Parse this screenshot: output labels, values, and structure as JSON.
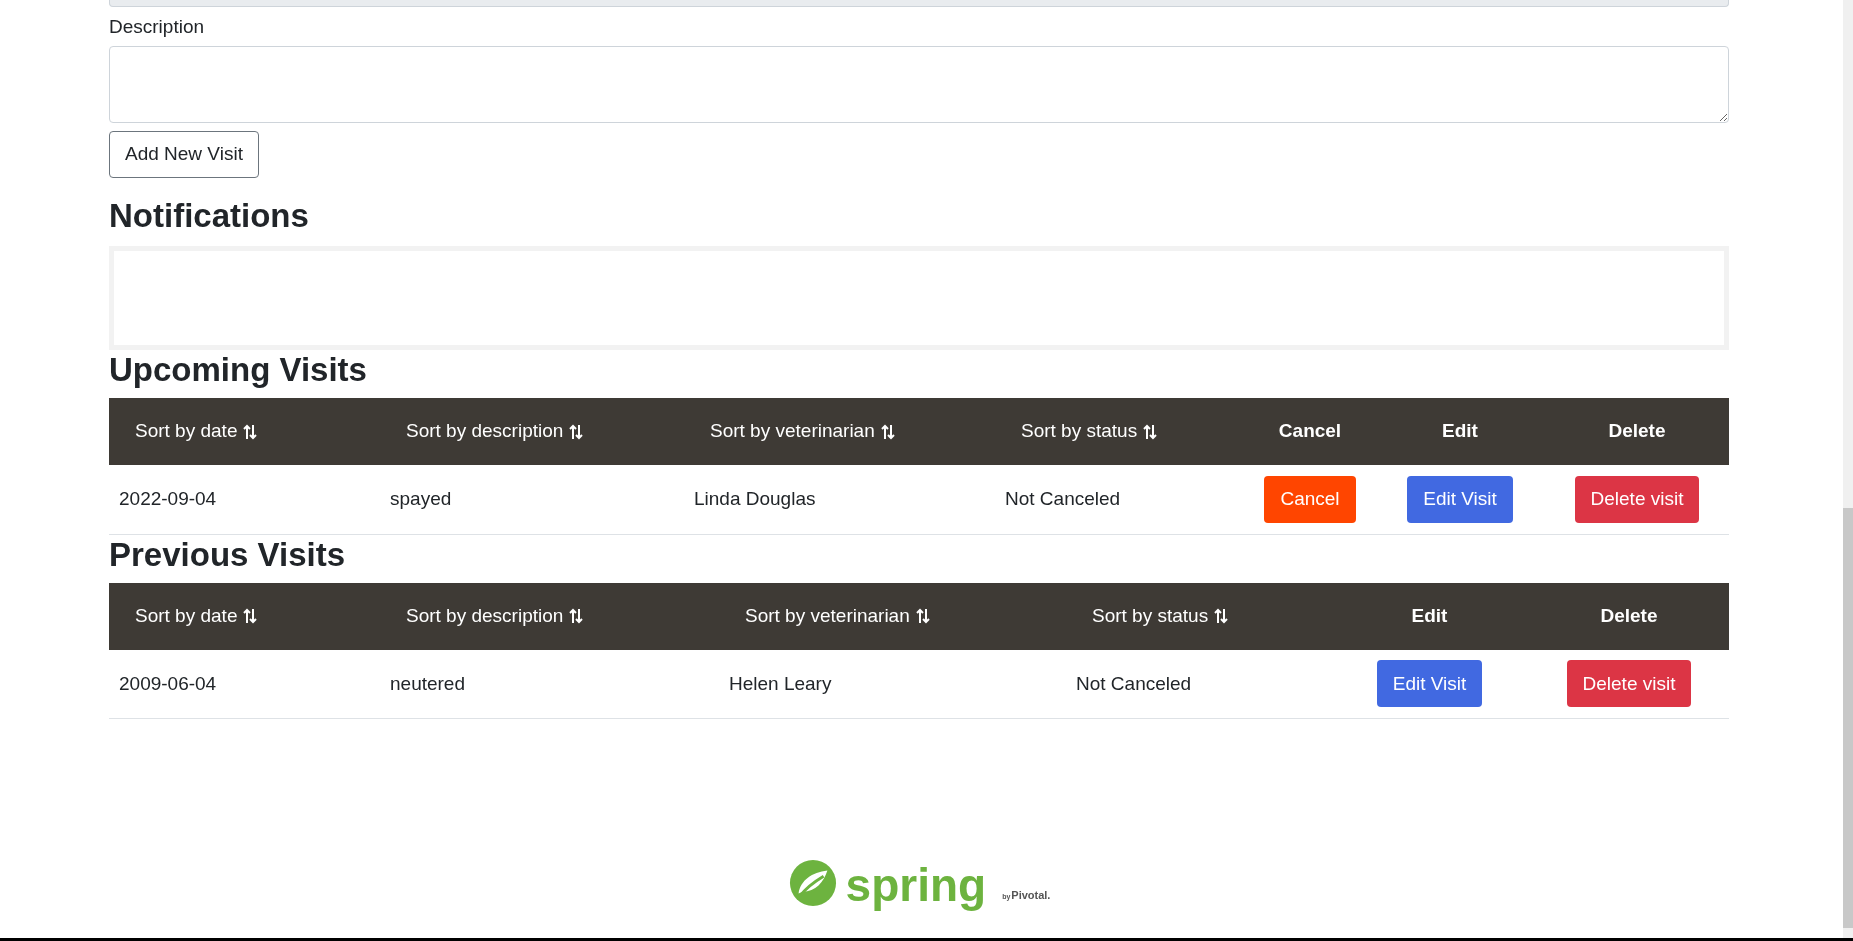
{
  "form": {
    "description_label": "Description",
    "add_button": "Add New Visit"
  },
  "notifications": {
    "title": "Notifications"
  },
  "upcoming": {
    "title": "Upcoming Visits",
    "columns": [
      {
        "label": "Sort by date",
        "kind": "sort"
      },
      {
        "label": "Sort by description",
        "kind": "sort"
      },
      {
        "label": "Sort by veterinarian",
        "kind": "sort"
      },
      {
        "label": "Sort by status",
        "kind": "sort"
      },
      {
        "label": "Cancel",
        "kind": "action"
      },
      {
        "label": "Edit",
        "kind": "action"
      },
      {
        "label": "Delete",
        "kind": "action"
      }
    ],
    "rows": [
      {
        "date": "2022-09-04",
        "description": "spayed",
        "veterinarian": "Linda Douglas",
        "status": "Not Canceled",
        "cancel": "Cancel",
        "edit": "Edit Visit",
        "delete": "Delete visit"
      }
    ]
  },
  "previous": {
    "title": "Previous Visits",
    "columns": [
      {
        "label": "Sort by date",
        "kind": "sort"
      },
      {
        "label": "Sort by description",
        "kind": "sort"
      },
      {
        "label": "Sort by veterinarian",
        "kind": "sort"
      },
      {
        "label": "Sort by status",
        "kind": "sort"
      },
      {
        "label": "Edit",
        "kind": "action"
      },
      {
        "label": "Delete",
        "kind": "action"
      }
    ],
    "rows": [
      {
        "date": "2009-06-04",
        "description": "neutered",
        "veterinarian": "Helen Leary",
        "status": "Not Canceled",
        "edit": "Edit Visit",
        "delete": "Delete visit"
      }
    ]
  },
  "footer": {
    "wordmark": "spring",
    "by": "by",
    "maker": "Pivotal."
  }
}
